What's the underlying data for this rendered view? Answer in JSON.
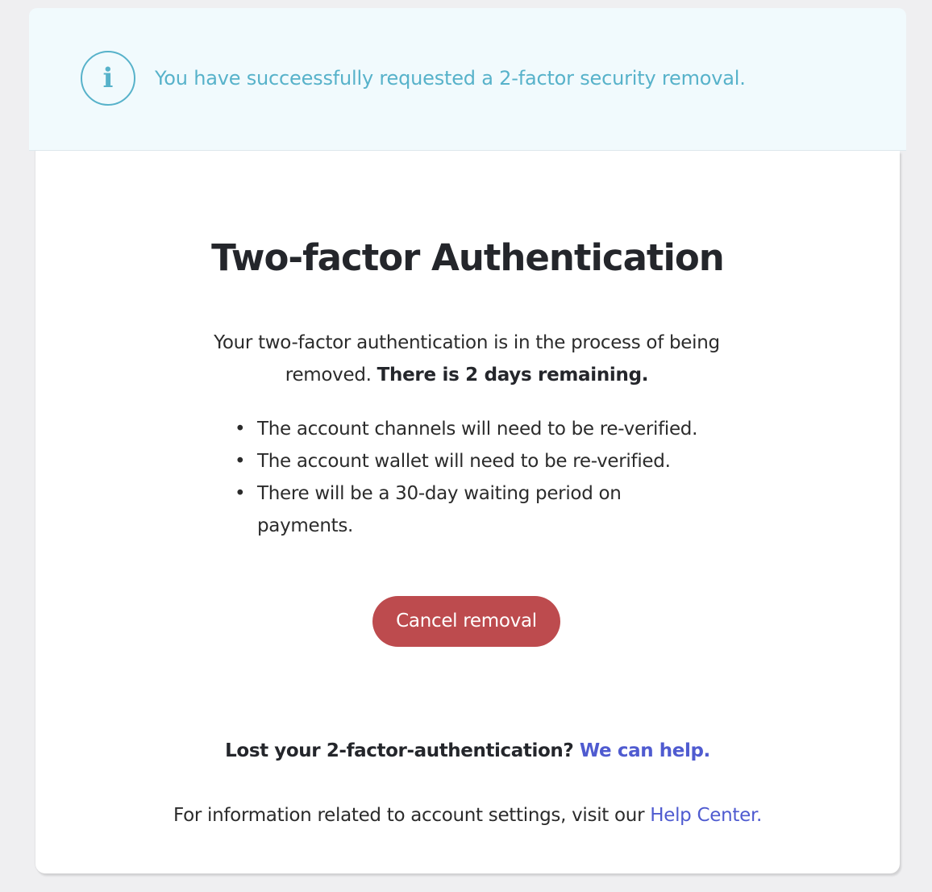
{
  "banner": {
    "icon": "info-icon",
    "icon_glyph": "i",
    "message": "You have succeessfully requested a 2-factor security removal."
  },
  "main": {
    "title": "Two-factor Authentication",
    "intro_text": "Your two-factor authentication is in the process of being removed. ",
    "intro_bold": "There is 2 days remaining.",
    "bullets": [
      "The account channels will need to be re-verified.",
      "The account wallet will need to be re-verified.",
      "There will be a 30-day waiting period on payments."
    ],
    "cancel_label": "Cancel removal"
  },
  "footer": {
    "lost_text": "Lost your 2-factor-authentication? ",
    "lost_link": "We can help.",
    "info_text": "For information related to account settings, visit our ",
    "info_link": "Help Center."
  },
  "colors": {
    "banner_bg": "#f1fafd",
    "banner_accent": "#57b2ca",
    "button_bg": "#bd4b4e",
    "link": "#4f5bd0"
  }
}
